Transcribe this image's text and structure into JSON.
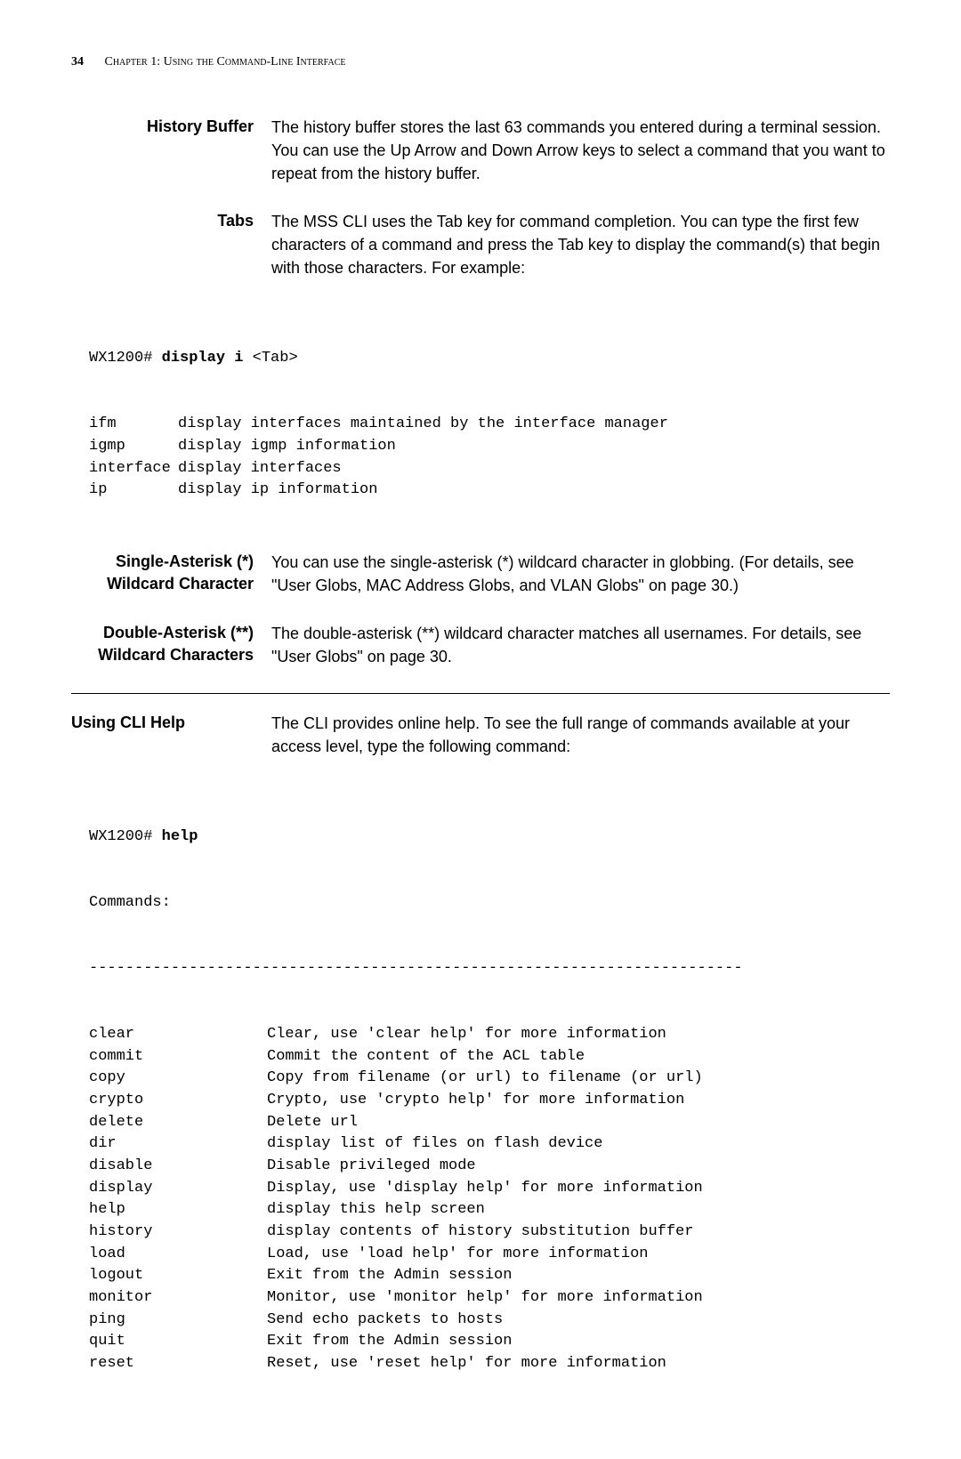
{
  "header": {
    "page_number": "34",
    "chapter_label": "Chapter 1: Using the Command-Line Interface"
  },
  "history_buffer": {
    "label": "History Buffer",
    "body": "The history buffer stores the last 63 commands you entered during a terminal session. You can use the Up Arrow and Down Arrow keys to select a command that you want to repeat from the history buffer."
  },
  "tabs": {
    "label": "Tabs",
    "body": "The MSS CLI uses the Tab key for command completion. You can type the first few characters of a command and press the Tab key to display the command(s) that begin with those characters. For example:"
  },
  "tabs_code": {
    "prompt": "WX1200# ",
    "typed": "display i ",
    "key": "<Tab>",
    "rows": [
      {
        "cmd": "ifm",
        "desc": "display interfaces maintained by the interface manager"
      },
      {
        "cmd": "igmp",
        "desc": "display igmp information"
      },
      {
        "cmd": "interface",
        "desc": "display interfaces"
      },
      {
        "cmd": "ip",
        "desc": "display ip information"
      }
    ]
  },
  "single_asterisk": {
    "label_l1": "Single-Asterisk (*)",
    "label_l2": "Wildcard Character",
    "body": "You can use the single-asterisk (*) wildcard character in globbing. (For details, see \"User Globs, MAC Address Globs, and VLAN Globs\" on page 30.)"
  },
  "double_asterisk": {
    "label_l1": "Double-Asterisk (**)",
    "label_l2": "Wildcard Characters",
    "body": "The double-asterisk (**) wildcard character matches all usernames. For details, see \"User Globs\" on page 30."
  },
  "using_cli_help": {
    "label": "Using CLI Help",
    "body": "The CLI provides online help. To see the full range of commands available at your access level, type the following command:"
  },
  "help_code": {
    "prompt": "WX1200# ",
    "typed": "help",
    "commands_label": "Commands:",
    "sep": "------------------------------------------------------------------------",
    "rows": [
      {
        "cmd": "clear",
        "desc": "Clear, use 'clear help' for more information"
      },
      {
        "cmd": "commit",
        "desc": "Commit the content of the ACL table"
      },
      {
        "cmd": "copy",
        "desc": "Copy from filename (or url) to filename (or url)"
      },
      {
        "cmd": "crypto",
        "desc": "Crypto, use 'crypto help' for more information"
      },
      {
        "cmd": "delete",
        "desc": "Delete url"
      },
      {
        "cmd": "dir",
        "desc": "display list of files on flash device"
      },
      {
        "cmd": "disable",
        "desc": "Disable privileged mode"
      },
      {
        "cmd": "display",
        "desc": "Display, use 'display help' for more information"
      },
      {
        "cmd": "help",
        "desc": "display this help screen"
      },
      {
        "cmd": "history",
        "desc": "display contents of history substitution buffer"
      },
      {
        "cmd": "load",
        "desc": "Load, use 'load help' for more information"
      },
      {
        "cmd": "logout",
        "desc": "Exit from the Admin session"
      },
      {
        "cmd": "monitor",
        "desc": "Monitor, use 'monitor help' for more information"
      },
      {
        "cmd": "ping",
        "desc": "Send echo packets to hosts"
      },
      {
        "cmd": "quit",
        "desc": "Exit from the Admin session"
      },
      {
        "cmd": "reset",
        "desc": "Reset, use 'reset help' for more information"
      }
    ]
  }
}
